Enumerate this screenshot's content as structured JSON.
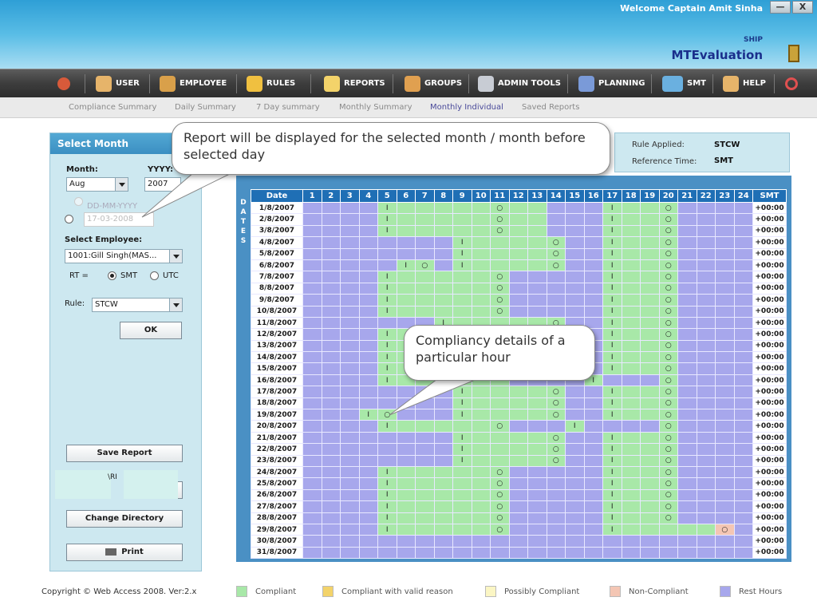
{
  "header": {
    "welcome": "Welcome Captain Amit Sinha",
    "ship_label": "SHIP",
    "app_name": "MTEvaluation",
    "min_label": "—",
    "close_label": "X"
  },
  "menu": [
    {
      "label": "USER",
      "icon": "user-icon"
    },
    {
      "label": "EMPLOYEE",
      "icon": "employee-icon"
    },
    {
      "label": "RULES",
      "icon": "rules-icon"
    },
    {
      "label": "REPORTS",
      "icon": "reports-icon",
      "active": true
    },
    {
      "label": "GROUPS",
      "icon": "groups-icon"
    },
    {
      "label": "ADMIN TOOLS",
      "icon": "admin-tools-icon"
    },
    {
      "label": "PLANNING",
      "icon": "planning-icon"
    },
    {
      "label": "SMT",
      "icon": "smt-icon"
    },
    {
      "label": "HELP",
      "icon": "help-icon"
    }
  ],
  "submenu": [
    "Compliance Summary",
    "Daily Summary",
    "7 Day summary",
    "Monthly Summary",
    "Monthly Individual",
    "Saved Reports"
  ],
  "submenu_active": "Monthly Individual",
  "left_panel": {
    "title": "Select Month",
    "month_label": "Month:",
    "year_label": "YYYY:",
    "month_value": "Aug",
    "year_value": "2007",
    "date_placeholder": "DD-MM-YYYY",
    "date_value": "17-03-2008",
    "employee_label": "Select Employee:",
    "employee_value": "1001:Gill Singh(MAS...",
    "rt_label": "RT =",
    "rt_smt": "SMT",
    "rt_utc": "UTC",
    "rule_label": "Rule:",
    "rule_value": "STCW",
    "ok_label": "OK",
    "save_report_label": "Save Report",
    "export_partial": "\\RI",
    "change_directory_label": "Change Directory",
    "print_label": "Print"
  },
  "info_panel": {
    "rule_applied_label": "Rule Applied:",
    "rule_applied_value": "STCW",
    "reference_time_label": "Reference Time:",
    "reference_time_value": "SMT"
  },
  "grid": {
    "vertical_label": [
      "D",
      "A",
      "T",
      "E",
      "S"
    ],
    "date_header": "Date",
    "hours": [
      "1",
      "2",
      "3",
      "4",
      "5",
      "6",
      "7",
      "8",
      "9",
      "10",
      "11",
      "12",
      "13",
      "14",
      "15",
      "16",
      "17",
      "18",
      "19",
      "20",
      "21",
      "22",
      "23",
      "24"
    ],
    "smt_header": "SMT",
    "rows": [
      {
        "date": "1/8/2007",
        "cells": "RRRRGGGGGGGGGRRRGGGGRRRR",
        "marks": {
          "5": "I",
          "11": "O",
          "17": "I",
          "20": "O"
        },
        "smt": "+00:00"
      },
      {
        "date": "2/8/2007",
        "cells": "RRRRGGGGGGGGGRRRGGGGRRRR",
        "marks": {
          "5": "I",
          "11": "O",
          "17": "I",
          "20": "O"
        },
        "smt": "+00:00"
      },
      {
        "date": "3/8/2007",
        "cells": "RRRRGGGGGGGGGRRRGGGGRRRR",
        "marks": {
          "5": "I",
          "11": "O",
          "17": "I",
          "20": "O"
        },
        "smt": "+00:00"
      },
      {
        "date": "4/8/2007",
        "cells": "RRRRRRRRGGGGGGRRGGGGRRRR",
        "marks": {
          "9": "I",
          "14": "O",
          "17": "I",
          "20": "O"
        },
        "smt": "+00:00"
      },
      {
        "date": "5/8/2007",
        "cells": "RRRRRRRRGGGGGGRRGGGGRRRR",
        "marks": {
          "9": "I",
          "14": "O",
          "17": "I",
          "20": "O"
        },
        "smt": "+00:00"
      },
      {
        "date": "6/8/2007",
        "cells": "RRRRRGGRGGGGGGRRGGGGRRRR",
        "marks": {
          "6": "I",
          "7": "O",
          "9": "I",
          "14": "O",
          "17": "I",
          "20": "O"
        },
        "smt": "+00:00"
      },
      {
        "date": "7/8/2007",
        "cells": "RRRRGGGGGGGRRRRRGGGGRRRR",
        "marks": {
          "5": "I",
          "11": "O",
          "17": "I",
          "20": "O"
        },
        "smt": "+00:00"
      },
      {
        "date": "8/8/2007",
        "cells": "RRRRGGGGGGGRRRRRGGGGRRRR",
        "marks": {
          "5": "I",
          "11": "O",
          "17": "I",
          "20": "O"
        },
        "smt": "+00:00"
      },
      {
        "date": "9/8/2007",
        "cells": "RRRRGGGGGGGRRRRRGGGGRRRR",
        "marks": {
          "5": "I",
          "11": "O",
          "17": "I",
          "20": "O"
        },
        "smt": "+00:00"
      },
      {
        "date": "10/8/2007",
        "cells": "RRRRGGGGGGGRRRRRGGGGRRRR",
        "marks": {
          "5": "I",
          "11": "O",
          "17": "I",
          "20": "O"
        },
        "smt": "+00:00"
      },
      {
        "date": "11/8/2007",
        "cells": "RRRRRRRGGGGGGGRRGGGGRRRR",
        "marks": {
          "8": "I",
          "14": "O",
          "17": "I",
          "20": "O"
        },
        "smt": "+00:00"
      },
      {
        "date": "12/8/2007",
        "cells": "RRRRGGGGGGGRRRRRGGGGRRRR",
        "marks": {
          "5": "I",
          "17": "I",
          "20": "O"
        },
        "smt": "+00:00"
      },
      {
        "date": "13/8/2007",
        "cells": "RRRRGGGGGGGRRRRRGGGGRRRR",
        "marks": {
          "5": "I",
          "17": "I",
          "20": "O"
        },
        "smt": "+00:00"
      },
      {
        "date": "14/8/2007",
        "cells": "RRRRGGGGGGGRRRRRGGGGRRRR",
        "marks": {
          "5": "I",
          "17": "I",
          "20": "O"
        },
        "smt": "+00:00"
      },
      {
        "date": "15/8/2007",
        "cells": "RRRRGGGGGGGRRRRRGGGGRRRR",
        "marks": {
          "5": "I",
          "17": "I",
          "20": "O"
        },
        "smt": "+00:00"
      },
      {
        "date": "16/8/2007",
        "cells": "RRRRGGGGGGGRRRRGRRRGRRRR",
        "marks": {
          "5": "I",
          "16": "I",
          "20": "O"
        },
        "smt": "+00:00"
      },
      {
        "date": "17/8/2007",
        "cells": "RRRRRRRRGGGGGGRRGGGGRRRR",
        "marks": {
          "9": "I",
          "14": "O",
          "17": "I",
          "20": "O"
        },
        "smt": "+00:00"
      },
      {
        "date": "18/8/2007",
        "cells": "RRRRRRRRGGGGGGRRGGGGRRRR",
        "marks": {
          "9": "I",
          "14": "O",
          "17": "I",
          "20": "O"
        },
        "smt": "+00:00"
      },
      {
        "date": "19/8/2007",
        "cells": "RRRGGRRRGGGGGGRRGGGGRRRR",
        "marks": {
          "4": "I",
          "5": "O",
          "9": "I",
          "14": "O",
          "17": "I",
          "20": "O"
        },
        "smt": "+00:00"
      },
      {
        "date": "20/8/2007",
        "cells": "RRRRGGGGGGGRRRGRRRRGRRRR",
        "marks": {
          "5": "I",
          "11": "O",
          "15": "I",
          "20": "O"
        },
        "smt": "+00:00"
      },
      {
        "date": "21/8/2007",
        "cells": "RRRRRRRRGGGGGGRRGGGGRRRR",
        "marks": {
          "9": "I",
          "14": "O",
          "17": "I",
          "20": "O"
        },
        "smt": "+00:00"
      },
      {
        "date": "22/8/2007",
        "cells": "RRRRRRRRGGGGGGRRGGGGRRRR",
        "marks": {
          "9": "I",
          "14": "O",
          "17": "I",
          "20": "O"
        },
        "smt": "+00:00"
      },
      {
        "date": "23/8/2007",
        "cells": "RRRRRRRRGGGGGGRRGGGGRRRR",
        "marks": {
          "9": "I",
          "14": "O",
          "17": "I",
          "20": "O"
        },
        "smt": "+00:00"
      },
      {
        "date": "24/8/2007",
        "cells": "RRRRGGGGGGGRRRRRGGGGRRRR",
        "marks": {
          "5": "I",
          "11": "O",
          "17": "I",
          "20": "O"
        },
        "smt": "+00:00"
      },
      {
        "date": "25/8/2007",
        "cells": "RRRRGGGGGGGRRRRRGGGGRRRR",
        "marks": {
          "5": "I",
          "11": "O",
          "17": "I",
          "20": "O"
        },
        "smt": "+00:00"
      },
      {
        "date": "26/8/2007",
        "cells": "RRRRGGGGGGGRRRRRGGGGRRRR",
        "marks": {
          "5": "I",
          "11": "O",
          "17": "I",
          "20": "O"
        },
        "smt": "+00:00"
      },
      {
        "date": "27/8/2007",
        "cells": "RRRRGGGGGGGRRRRRGGGGRRRR",
        "marks": {
          "5": "I",
          "11": "O",
          "17": "I",
          "20": "O"
        },
        "smt": "+00:00"
      },
      {
        "date": "28/8/2007",
        "cells": "RRRRGGGGGGGRRRRRGGGGRRRR",
        "marks": {
          "5": "I",
          "11": "O",
          "17": "I",
          "20": "O"
        },
        "smt": "+00:00"
      },
      {
        "date": "29/8/2007",
        "cells": "RRRRGGGGGGGRRRRRGGGGGGNR",
        "marks": {
          "5": "I",
          "11": "O",
          "17": "I",
          "23": "O"
        },
        "smt": "+00:00"
      },
      {
        "date": "30/8/2007",
        "cells": "RRRRRRRRRRRRRRRRRRRRRRRR",
        "marks": {},
        "smt": "+00:00"
      },
      {
        "date": "31/8/2007",
        "cells": "RRRRRRRRRRRRRRRRRRRRRRRR",
        "marks": {},
        "smt": "+00:00"
      }
    ]
  },
  "callouts": {
    "report_note": "Report will be displayed for the selected month / month before selected day",
    "compliancy_note": "Compliancy details of a particular hour"
  },
  "footer": {
    "copyright": "Copyright © Web Access 2008. Ver:2.x",
    "legend": [
      {
        "label": "Compliant",
        "color": "#a8e8a8"
      },
      {
        "label": "Compliant with valid reason",
        "color": "#f3d36a"
      },
      {
        "label": "Possibly Compliant",
        "color": "#fbf6c4"
      },
      {
        "label": "Non-Compliant",
        "color": "#f4c6b4"
      },
      {
        "label": "Rest Hours",
        "color": "#a7a7ec"
      }
    ]
  }
}
